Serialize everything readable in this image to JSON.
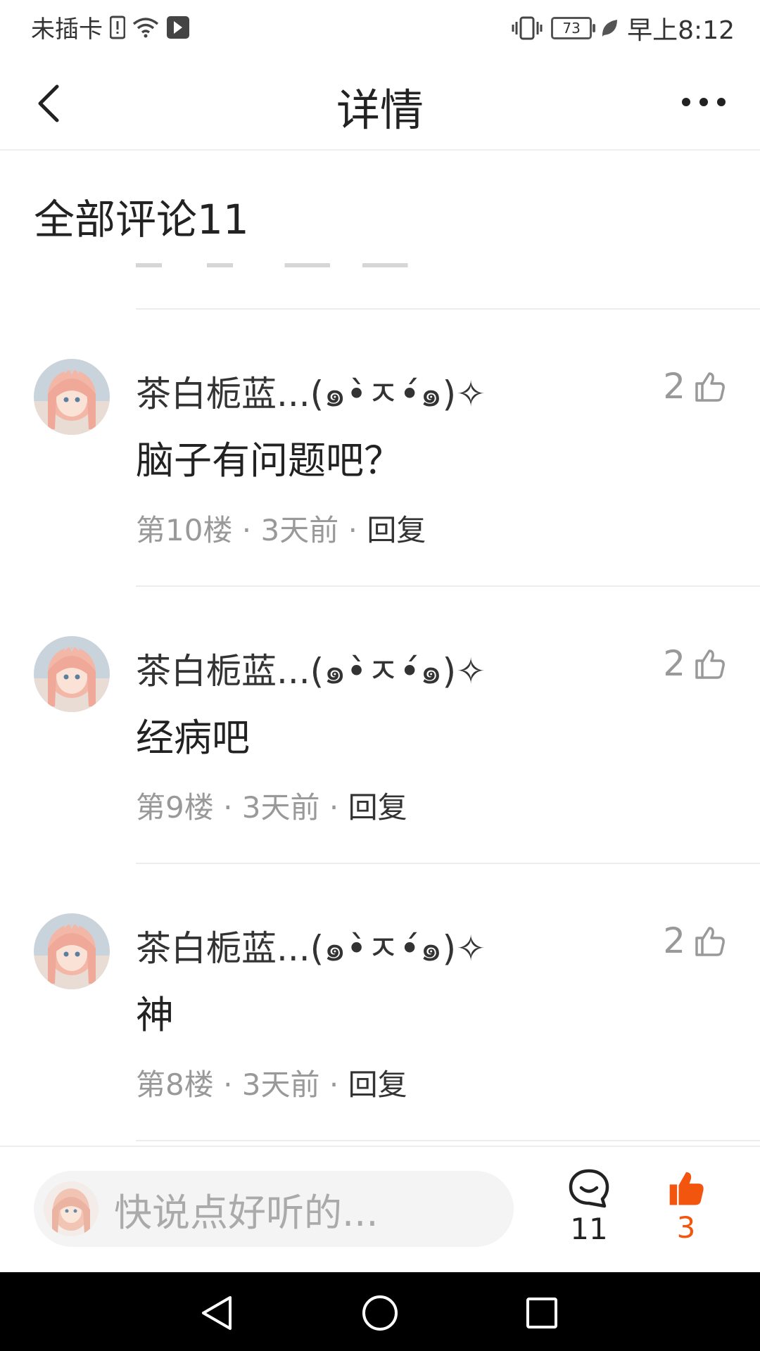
{
  "status_bar": {
    "carrier": "未插卡",
    "battery": "73",
    "time": "早上8:12"
  },
  "header": {
    "title": "详情"
  },
  "comments_section": {
    "title": "全部评论11"
  },
  "comments": [
    {
      "name": "茶白栀蓝...(๑•̀ㅈ•́๑)✧",
      "text": "脑子有问题吧？",
      "floor": "第10楼",
      "time": "3天前",
      "reply": "回复",
      "likes": "2"
    },
    {
      "name": "茶白栀蓝...(๑•̀ㅈ•́๑)✧",
      "text": "经病吧",
      "floor": "第9楼",
      "time": "3天前",
      "reply": "回复",
      "likes": "2"
    },
    {
      "name": "茶白栀蓝...(๑•̀ㅈ•́๑)✧",
      "text": "神",
      "floor": "第8楼",
      "time": "3天前",
      "reply": "回复",
      "likes": "2"
    }
  ],
  "bottom_bar": {
    "input_placeholder": "快说点好听的...",
    "comment_count": "11",
    "like_count": "3"
  },
  "colors": {
    "accent": "#f2550d",
    "meta_gray": "#999999"
  },
  "icons": [
    "back-icon",
    "more-icon",
    "thumbs-up-icon",
    "comment-icon",
    "thumbs-up-filled-icon",
    "nav-back-icon",
    "nav-home-icon",
    "nav-recents-icon"
  ]
}
